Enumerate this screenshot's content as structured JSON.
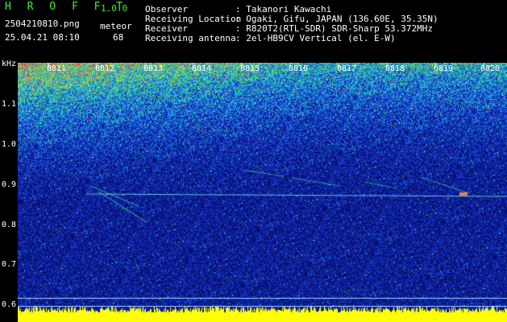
{
  "header": {
    "app_name": "H R O F F T",
    "version": "1.0.0",
    "filename": "2504210810.png",
    "mode_label": "meteor",
    "timestamp": "25.04.21 08:10",
    "count": "68"
  },
  "info": {
    "observer_label": "Observer",
    "observer_value": ": Takanori Kawachi",
    "location_label": "Receiving Location",
    "location_value": ": Ogaki, Gifu, JAPAN (136.60E, 35.35N)",
    "receiver_label": "Receiver",
    "receiver_value": ": R820T2(RTL-SDR) SDR-Sharp 53.372MHz",
    "antenna_label": "Receiving antenna",
    "antenna_value": ": 2el-HB9CV Vertical (el. E-W)"
  },
  "axis": {
    "unit": "kHz",
    "y_ticks": [
      "1.1",
      "1.0",
      "0.9",
      "0.8",
      "0.7",
      "0.6"
    ],
    "x_ticks": [
      "0811",
      "0812",
      "0813",
      "0814",
      "0815",
      "0816",
      "0817",
      "0818",
      "0819",
      "0820"
    ]
  },
  "colors": {
    "background": "#000000",
    "header_green": "#3cf03c",
    "noise_floor": "#0a1a8a",
    "baseline_band": "#ffff00"
  }
}
